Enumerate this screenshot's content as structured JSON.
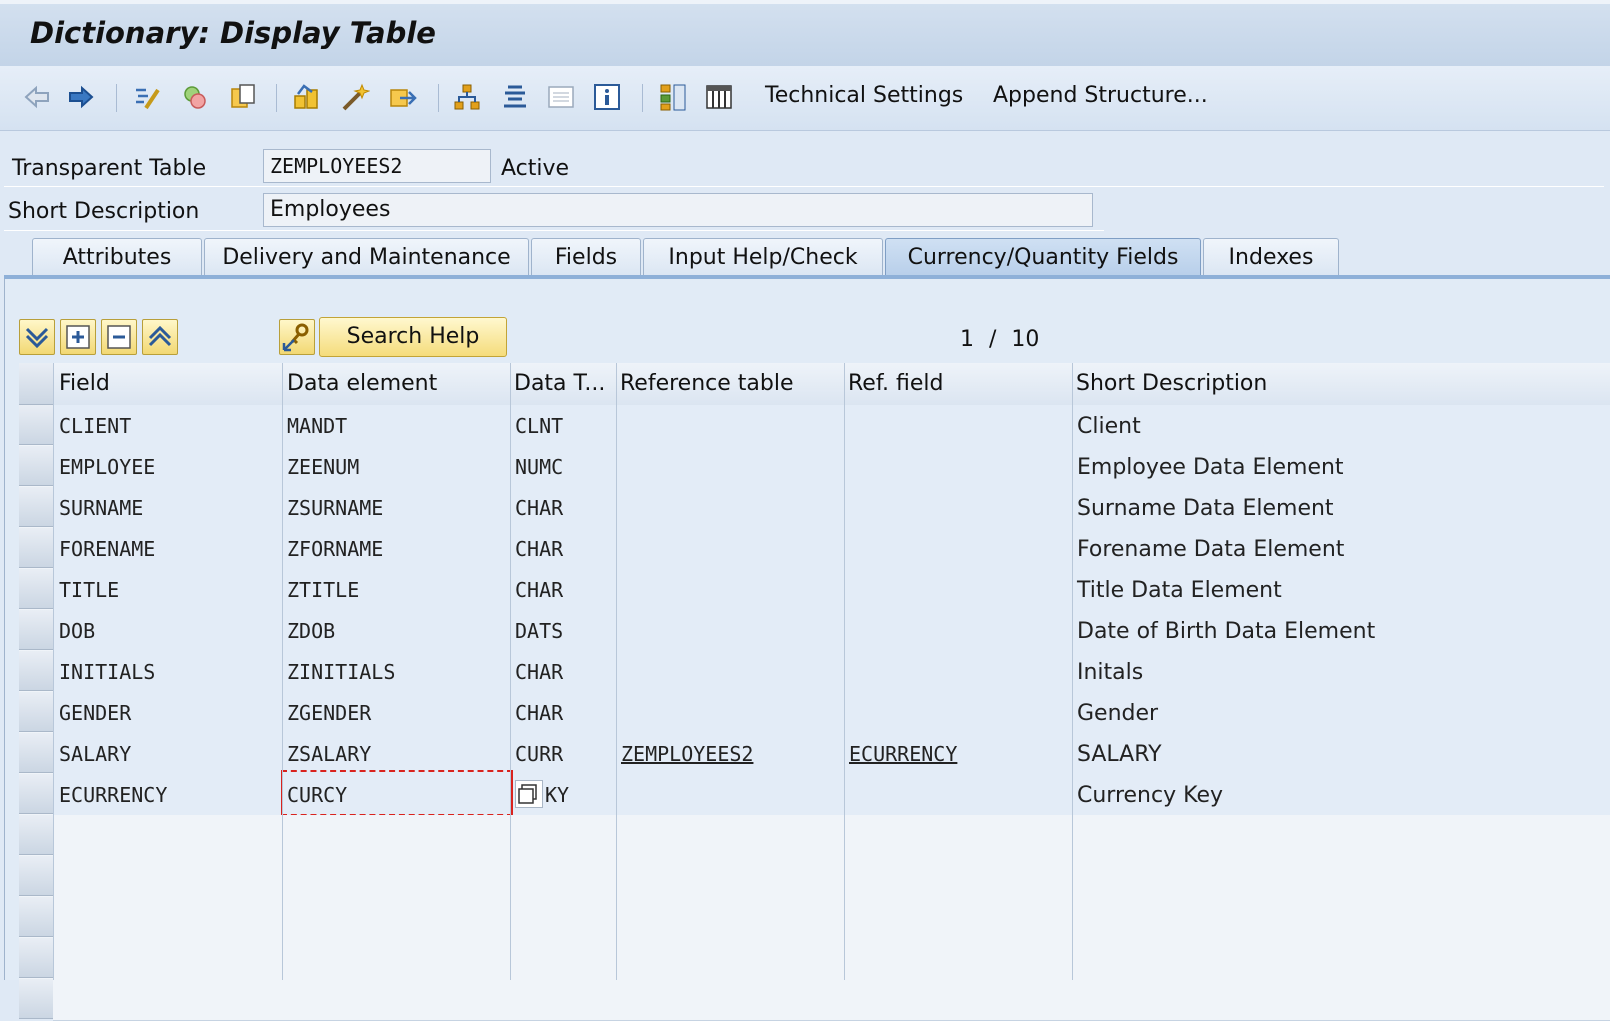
{
  "window": {
    "title": "Dictionary: Display Table"
  },
  "toolbar": {
    "icons": [
      "back-arrow-icon",
      "forward-arrow-icon",
      "toggle-change-icon",
      "other-object-icon",
      "copy-object-icon",
      "check-icon",
      "activate-icon",
      "test-icon",
      "hierarchy-icon",
      "where-used-icon",
      "layout-icon",
      "information-icon",
      "object-list-icon",
      "columns-icon"
    ],
    "technical_settings": "Technical Settings",
    "append_structure": "Append Structure..."
  },
  "header": {
    "table_type_label": "Transparent Table",
    "table_name": "ZEMPLOYEES2",
    "status": "Active",
    "short_desc_label": "Short Description",
    "short_desc": "Employees"
  },
  "tabs": [
    {
      "label": "Attributes"
    },
    {
      "label": "Delivery and Maintenance"
    },
    {
      "label": "Fields"
    },
    {
      "label": "Input Help/Check"
    },
    {
      "label": "Currency/Quantity Fields",
      "active": true
    },
    {
      "label": "Indexes"
    }
  ],
  "grid_toolbar": {
    "search_help": "Search Help",
    "page": "1",
    "page_sep": "/",
    "total": "10"
  },
  "columns": [
    "Field",
    "Data element",
    "Data T...",
    "Reference table",
    "Ref. field",
    "Short Description"
  ],
  "rows": [
    {
      "field": "CLIENT",
      "element": "MANDT",
      "type": "CLNT",
      "reftable": "",
      "reffield": "",
      "desc": "Client"
    },
    {
      "field": "EMPLOYEE",
      "element": "ZEENUM",
      "type": "NUMC",
      "reftable": "",
      "reffield": "",
      "desc": "Employee Data Element"
    },
    {
      "field": "SURNAME",
      "element": "ZSURNAME",
      "type": "CHAR",
      "reftable": "",
      "reffield": "",
      "desc": "Surname Data Element"
    },
    {
      "field": "FORENAME",
      "element": "ZFORNAME",
      "type": "CHAR",
      "reftable": "",
      "reffield": "",
      "desc": "Forename Data Element"
    },
    {
      "field": "TITLE",
      "element": "ZTITLE",
      "type": "CHAR",
      "reftable": "",
      "reffield": "",
      "desc": "Title Data Element"
    },
    {
      "field": "DOB",
      "element": "ZDOB",
      "type": "DATS",
      "reftable": "",
      "reffield": "",
      "desc": "Date of Birth Data Element"
    },
    {
      "field": "INITIALS",
      "element": "ZINITIALS",
      "type": "CHAR",
      "reftable": "",
      "reffield": "",
      "desc": "Initals"
    },
    {
      "field": "GENDER",
      "element": "ZGENDER",
      "type": "CHAR",
      "reftable": "",
      "reffield": "",
      "desc": "Gender"
    },
    {
      "field": "SALARY",
      "element": "ZSALARY",
      "type": "CURR",
      "reftable": "ZEMPLOYEES2",
      "reffield": "ECURRENCY",
      "desc": "SALARY"
    },
    {
      "field": "ECURRENCY",
      "element": "CURCY",
      "type": "KY",
      "reftable": "",
      "reffield": "",
      "desc": "Currency Key"
    }
  ],
  "colors": {
    "accent": "#8eb0d8",
    "focus": "#d9231e",
    "button_yellow": "#f5dc7b"
  }
}
